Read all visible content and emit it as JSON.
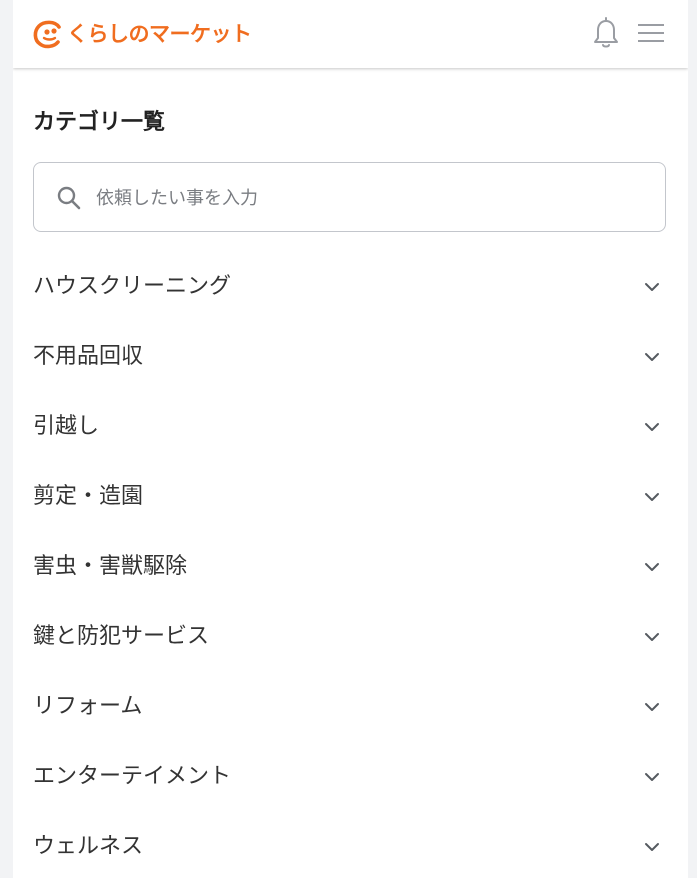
{
  "header": {
    "logo_text": "くらしのマーケット",
    "brand_color": "#f06d1f",
    "notification_icon": "bell-icon",
    "menu_icon": "hamburger-menu-icon"
  },
  "page": {
    "title": "カテゴリ一覧"
  },
  "search": {
    "placeholder": "依頼したい事を入力",
    "value": "",
    "icon": "search-icon"
  },
  "categories": [
    {
      "label": "ハウスクリーニング",
      "icon": "chevron-down-icon"
    },
    {
      "label": "不用品回収",
      "icon": "chevron-down-icon"
    },
    {
      "label": "引越し",
      "icon": "chevron-down-icon"
    },
    {
      "label": "剪定・造園",
      "icon": "chevron-down-icon"
    },
    {
      "label": "害虫・害獣駆除",
      "icon": "chevron-down-icon"
    },
    {
      "label": "鍵と防犯サービス",
      "icon": "chevron-down-icon"
    },
    {
      "label": "リフォーム",
      "icon": "chevron-down-icon"
    },
    {
      "label": "エンターテイメント",
      "icon": "chevron-down-icon"
    },
    {
      "label": "ウェルネス",
      "icon": "chevron-down-icon"
    }
  ]
}
